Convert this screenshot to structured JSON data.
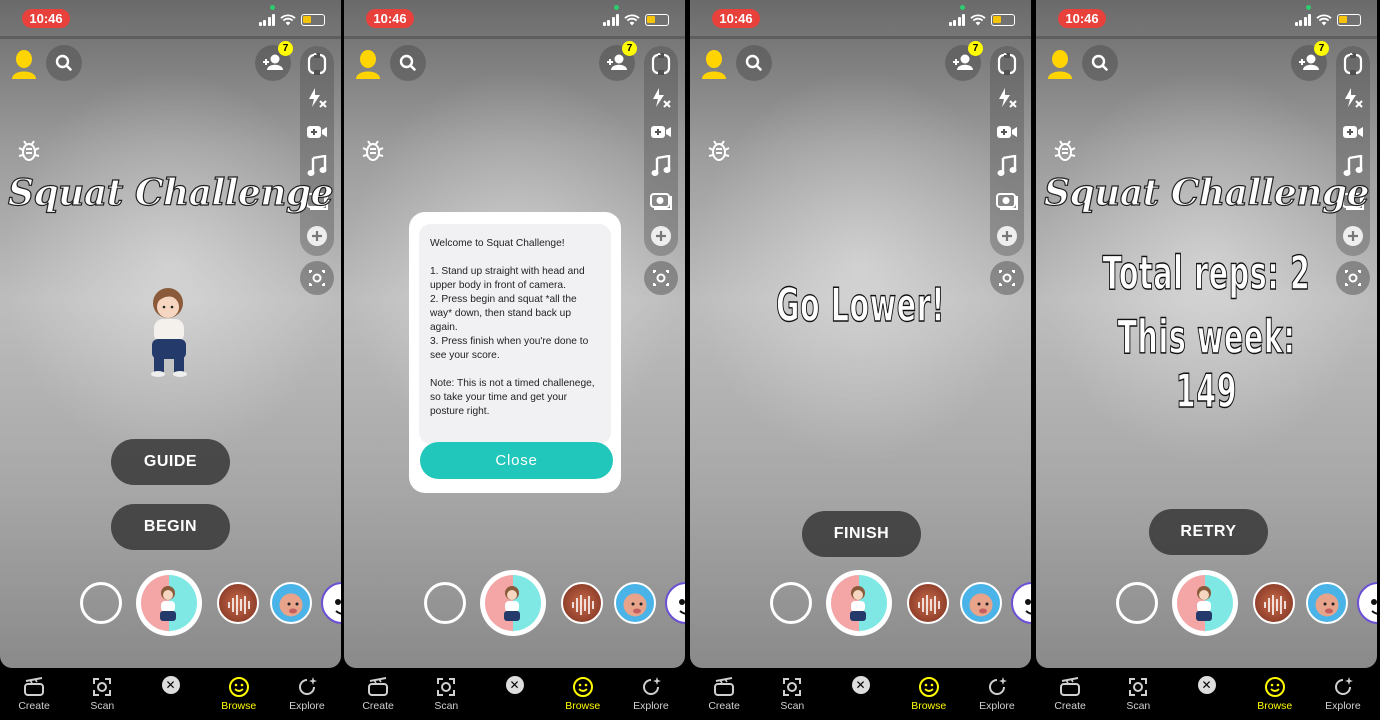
{
  "status": {
    "time": "10:46",
    "friend_badge": "7"
  },
  "lens": {
    "title": "Squat Challenge",
    "guide_label": "GUIDE",
    "begin_label": "BEGIN",
    "finish_label": "FINISH",
    "retry_label": "RETRY",
    "prompt": "Go Lower!",
    "total_reps": "Total reps: 2",
    "this_week": "This week: 149"
  },
  "modal": {
    "body": "Welcome to Squat Challenge!\n\n1. Stand up straight with head and upper body in front of camera.\n2. Press begin and squat *all the way* down, then stand back up again.\n3. Press finish when you're done to see your score.\n\nNote: This is not a timed challenege, so take your time and get your posture right.",
    "close_label": "Close"
  },
  "nav": {
    "items": [
      {
        "label": "Create",
        "icon": "create-icon"
      },
      {
        "label": "Scan",
        "icon": "scan-icon"
      },
      {
        "label": "Browse",
        "icon": "smiley-icon",
        "active": true
      },
      {
        "label": "Explore",
        "icon": "explore-icon"
      }
    ]
  },
  "colors": {
    "accent": "#fffc00",
    "close_button": "#22c7bb",
    "time_pill": "#e8413c"
  }
}
